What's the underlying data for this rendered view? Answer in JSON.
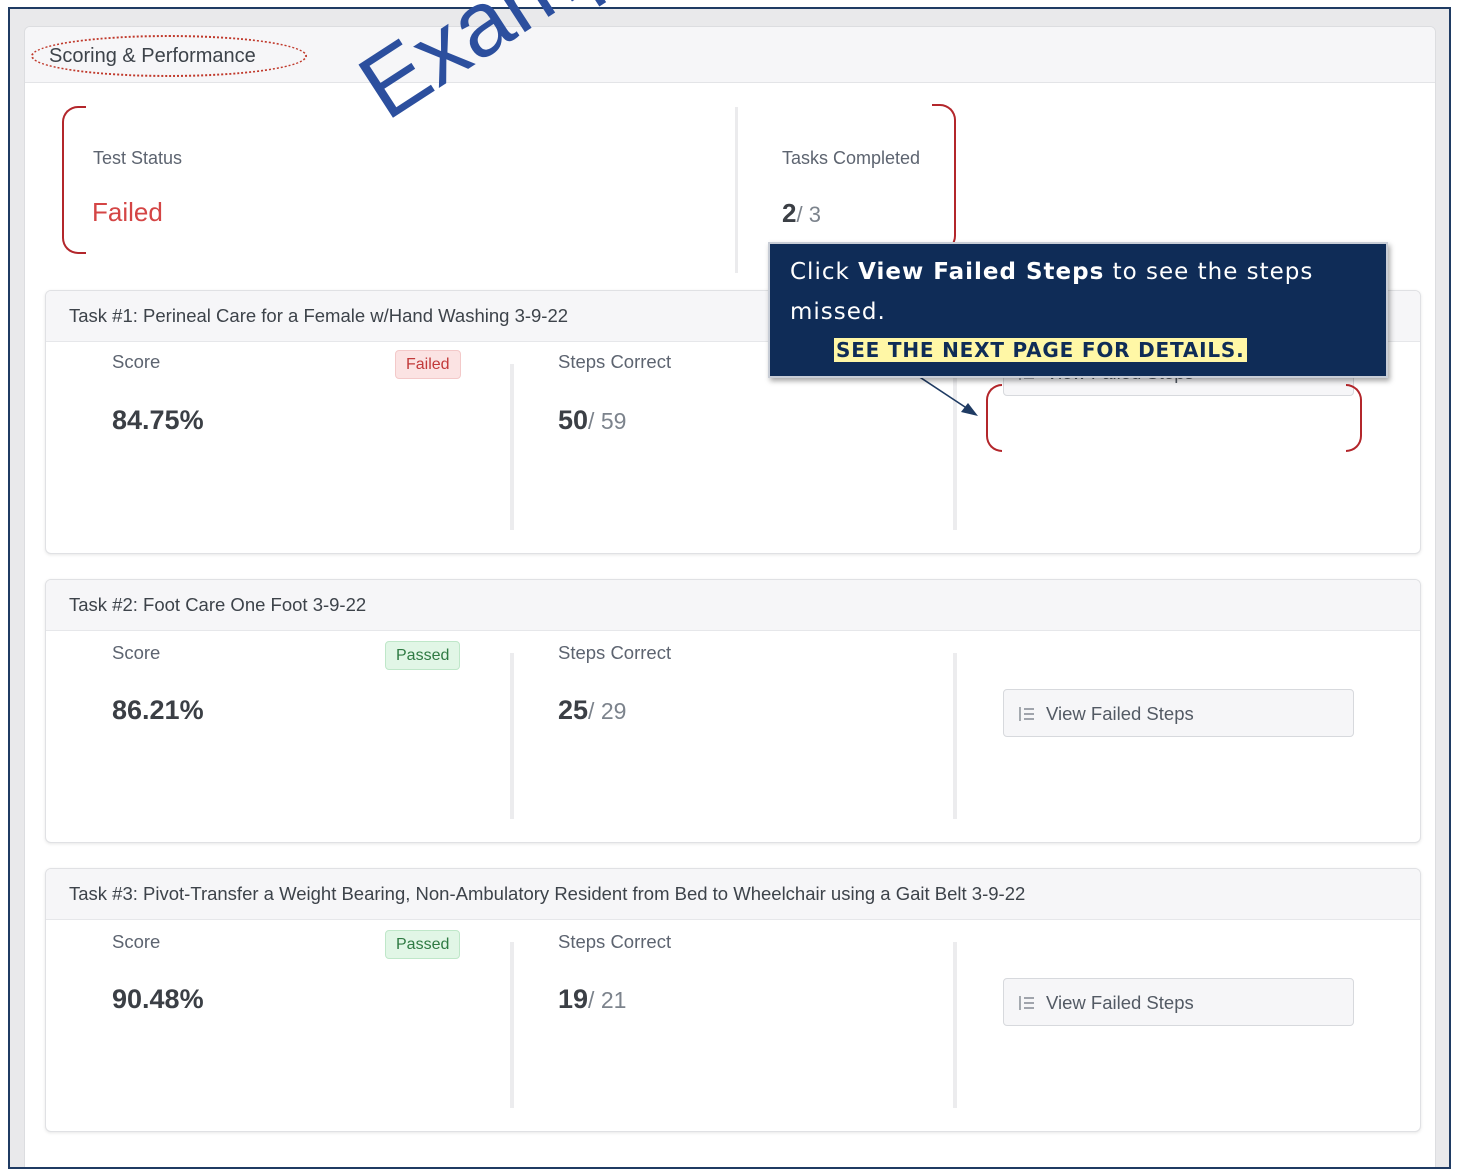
{
  "card": {
    "title": "Scoring & Performance"
  },
  "summary": {
    "status_label": "Test Status",
    "status_value": "Failed",
    "tasks_label": "Tasks Completed",
    "tasks_done": "2",
    "tasks_total": "/ 3"
  },
  "watermark": "Example",
  "callout": {
    "line1_pre": "Click ",
    "line1_bold": "View Failed Steps",
    "line1_post": " to see the steps",
    "line2": "missed.",
    "highlight": "SEE THE NEXT PAGE FOR DETAILS."
  },
  "tasks": [
    {
      "title": "Task #1: Perineal Care for a Female w/Hand Washing 3-9-22",
      "score_label": "Score",
      "badge": "Failed",
      "score": "84.75%",
      "steps_label": "Steps Correct",
      "steps_correct": "50",
      "steps_total": "/ 59",
      "button": "View Failed Steps"
    },
    {
      "title": "Task #2: Foot Care One Foot 3-9-22",
      "score_label": "Score",
      "badge": "Passed",
      "score": "86.21%",
      "steps_label": "Steps Correct",
      "steps_correct": "25",
      "steps_total": "/ 29",
      "button": "View Failed Steps"
    },
    {
      "title": "Task #3: Pivot-Transfer a Weight Bearing, Non-Ambulatory Resident from Bed to Wheelchair using a Gait Belt 3-9-22",
      "score_label": "Score",
      "badge": "Passed",
      "score": "90.48%",
      "steps_label": "Steps Correct",
      "steps_correct": "19",
      "steps_total": "/ 21",
      "button": "View Failed Steps"
    }
  ],
  "colors": {
    "failed": "#d44545",
    "passed_badge": "#2f7a43",
    "callout_bg": "#0f2c57",
    "annotation_red": "#b3262b",
    "watermark_blue": "#2c4f9e"
  },
  "icons": {
    "view_failed_steps": "list-numbered-icon",
    "callout_pointer": "arrow-pointer"
  }
}
